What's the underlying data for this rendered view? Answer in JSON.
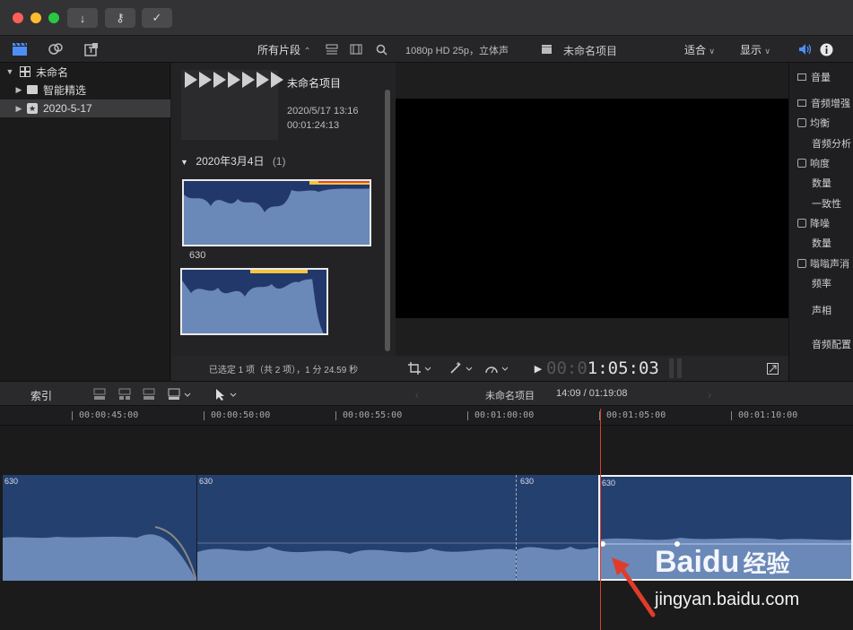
{
  "library": {
    "items": [
      {
        "label": "未命名",
        "expanded": true
      },
      {
        "label": "智能精选"
      },
      {
        "label": "2020-5-17",
        "selected": true
      }
    ]
  },
  "browser": {
    "filter_label": "所有片段",
    "project": {
      "name": "未命名项目",
      "date": "2020/5/17 13:16",
      "duration": "00:01:24:13"
    },
    "group": {
      "label": "2020年3月4日",
      "count": "(1)"
    },
    "clip_name": "630",
    "status": "已选定 1 项（共 2 项），1 分 24.59 秒"
  },
  "viewer": {
    "format": "1080p HD 25p，立体声",
    "project_name": "未命名项目",
    "fit_label": "适合",
    "display_label": "显示",
    "timecode_dim": "00:0",
    "timecode": "1:05:03"
  },
  "inspector": {
    "rows": [
      {
        "label": "音量",
        "kind": "header"
      },
      {
        "label": "音频增强",
        "kind": "header"
      },
      {
        "label": "均衡",
        "kind": "check"
      },
      {
        "label": "音频分析",
        "kind": "sub"
      },
      {
        "label": "响度",
        "kind": "check"
      },
      {
        "label": "数量",
        "kind": "sub"
      },
      {
        "label": "一致性",
        "kind": "sub"
      },
      {
        "label": "降噪",
        "kind": "check"
      },
      {
        "label": "数量",
        "kind": "sub"
      },
      {
        "label": "嗡嗡声消",
        "kind": "check"
      },
      {
        "label": "频率",
        "kind": "sub"
      },
      {
        "label": "声相",
        "kind": "plain"
      },
      {
        "label": "音频配置",
        "kind": "plain"
      }
    ]
  },
  "timeline": {
    "index_label": "索引",
    "project_name": "未命名项目",
    "position": "14:09 / 01:19:08",
    "ruler": [
      "00:00:45:00",
      "00:00:50:00",
      "00:00:55:00",
      "00:01:00:00",
      "00:01:05:00",
      "00:01:10:00"
    ],
    "clips": [
      "630",
      "630",
      "630",
      "630"
    ]
  },
  "watermark": {
    "brand": "Baidu",
    "brand_cn": "经验",
    "url": "jingyan.baidu.com"
  },
  "colors": {
    "accent": "#4e8ef7",
    "playhead": "#e03c2a",
    "clip": "#23406e",
    "waveform": "#6a88b8"
  }
}
